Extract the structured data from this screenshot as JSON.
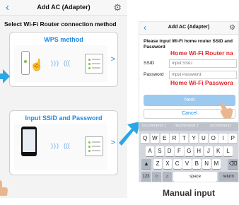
{
  "left_screen": {
    "title": "Add AC (Adapter)",
    "subtitle": "Select Wi-Fi Router connection method",
    "options": [
      {
        "label": "WPS method"
      },
      {
        "label": "Input SSID and Password"
      }
    ]
  },
  "right_screen": {
    "title": "Add AC (Adapter)",
    "description": "Please input Wi-Fi home router SSID and Password",
    "ssid_label": "SSID",
    "ssid_placeholder": "Input SSID",
    "password_label": "Password",
    "password_placeholder": "Input Password",
    "next_label": "Next",
    "cancel_label": "Cancel",
    "overlay_router_name": "Home Wi-Fi Router na",
    "overlay_password": "Home Wi-Fi Passwora",
    "keyboard": {
      "suggestions": [
        "recommend 1",
        "recommend 2",
        "recommend"
      ],
      "row1": [
        "Q",
        "W",
        "E",
        "R",
        "T",
        "Y",
        "U",
        "O",
        "I",
        "P"
      ],
      "row2": [
        "A",
        "S",
        "D",
        "F",
        "G",
        "H",
        "J",
        "K",
        "L"
      ],
      "row3": [
        "Z",
        "X",
        "C",
        "V",
        "B",
        "N",
        "M"
      ],
      "shift_icon": "up-arrow-icon",
      "backspace_icon": "backspace-icon",
      "num_key": "123",
      "emoji_icon": "emoji-icon",
      "mic_icon": "microphone-icon",
      "space_label": "space",
      "return_label": "return"
    }
  },
  "caption": "Manual input",
  "colors": {
    "accent_blue": "#1e88e5",
    "overlay_red": "#e3262b",
    "arrow_blue": "#2aa7e4",
    "hand_skin": "#e9b78f"
  }
}
